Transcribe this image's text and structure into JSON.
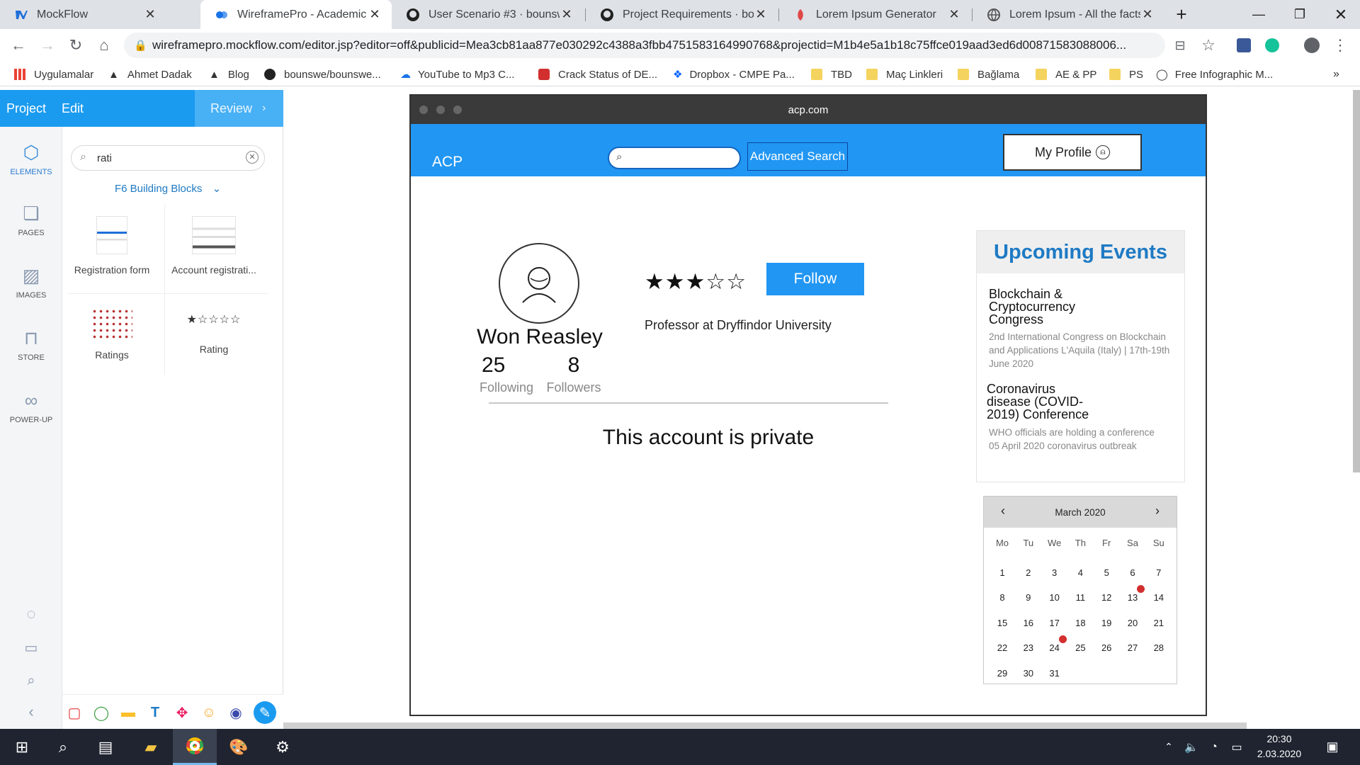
{
  "browser": {
    "tabs": [
      {
        "title": "MockFlow",
        "icon": "mockflow-icon"
      },
      {
        "title": "WireframePro - Academic Co",
        "icon": "wireframepro-icon"
      },
      {
        "title": "User Scenario #3 · bounswe/",
        "icon": "github-icon"
      },
      {
        "title": "Project Requirements · boun",
        "icon": "github-icon"
      },
      {
        "title": "Lorem Ipsum Generator",
        "icon": "lorem-icon"
      },
      {
        "title": "Lorem Ipsum - All the facts -",
        "icon": "globe-icon"
      }
    ],
    "url": "wireframepro.mockflow.com/editor.jsp?editor=off&publicid=Mea3cb81aa877e030292c4388a3fbb4751583164990768&projectid=M1b4e5a1b18c75ffce019aad3ed6d00871583088006...",
    "bookmarks": [
      "Uygulamalar",
      "Ahmet Dadak",
      "Blog",
      "bounswe/bounswe...",
      "YouTube to Mp3 C...",
      "Crack Status of DE...",
      "Dropbox - CMPE Pa...",
      "TBD",
      "Maç Linkleri",
      "Bağlama",
      "AE & PP",
      "PS",
      "Free Infographic M..."
    ]
  },
  "mockflow": {
    "menu": {
      "project": "Project",
      "edit": "Edit",
      "review": "Review"
    },
    "rail": [
      "ELEMENTS",
      "PAGES",
      "IMAGES",
      "STORE",
      "POWER-UP"
    ],
    "search_value": "rati",
    "library": "F6 Building Blocks",
    "items": [
      "Registration form",
      "Account registrati...",
      "Ratings",
      "Rating"
    ]
  },
  "mock": {
    "window_title": "acp.com",
    "logo": "ACP",
    "advanced_search": "Advanced Search",
    "my_profile": "My Profile",
    "name": "Won Reasley",
    "following_count": "25",
    "following_label": "Following",
    "followers_count": "8",
    "followers_label": "Followers",
    "rating": 3,
    "rating_max": 5,
    "follow_btn": "Follow",
    "bio": "Professor at Dryffindor University",
    "private_msg": "This account is private",
    "events_title": "Upcoming Events",
    "events": [
      {
        "title": "Blockchain & Cryptocurrency Congress",
        "desc": "2nd International Congress on Blockchain and Applications L'Aquila (Italy) | 17th-19th June 2020"
      },
      {
        "title": "Coronavirus disease (COVID-2019) Conference",
        "desc": "WHO officials are holding a conference 05 April 2020 coronavirus outbreak"
      }
    ],
    "calendar": {
      "month": "March 2020",
      "dow": [
        "Mo",
        "Tu",
        "We",
        "Th",
        "Fr",
        "Sa",
        "Su"
      ],
      "days": 31,
      "first_offset": 0,
      "marked_days": [
        13,
        24
      ]
    }
  },
  "taskbar": {
    "time": "20:30",
    "date": "2.03.2020"
  }
}
